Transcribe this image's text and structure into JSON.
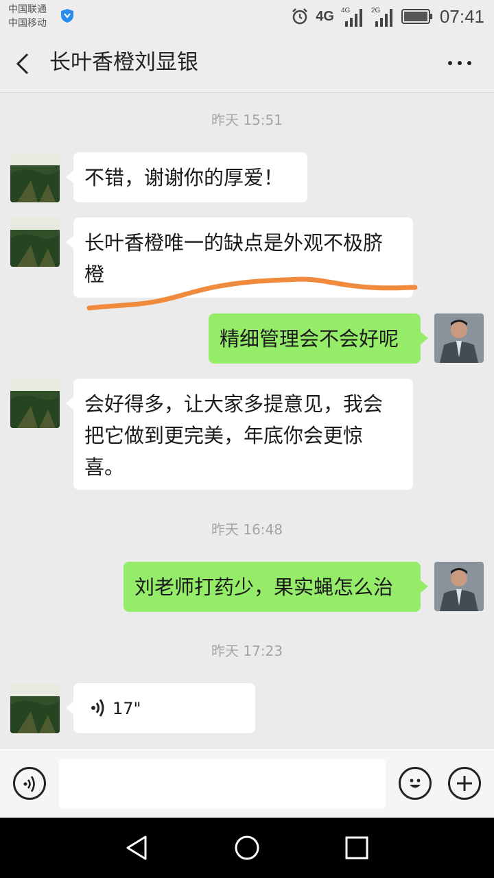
{
  "status_bar": {
    "carrier_1": "中国联通",
    "carrier_2": "中国移动",
    "network_1": "4G",
    "network_2": "4G",
    "network_3": "2G",
    "time": "07:41"
  },
  "header": {
    "title": "长叶香橙刘显银"
  },
  "messages": [
    {
      "kind": "timestamp",
      "text": "昨天 15:51"
    },
    {
      "kind": "incoming",
      "text": "不错，谢谢你的厚爱！"
    },
    {
      "kind": "incoming",
      "text": "长叶香橙唯一的缺点是外观不极脐橙"
    },
    {
      "kind": "outgoing",
      "text": "精细管理会不会好呢"
    },
    {
      "kind": "incoming",
      "text": "会好得多，让大家多提意见，我会把它做到更完美，年底你会更惊喜。"
    },
    {
      "kind": "timestamp",
      "text": "昨天 16:48"
    },
    {
      "kind": "outgoing",
      "text": "刘老师打药少，果实蝇怎么治"
    },
    {
      "kind": "timestamp",
      "text": "昨天 17:23"
    },
    {
      "kind": "incoming-voice",
      "duration": "17\""
    }
  ],
  "colors": {
    "chat_bg": "#ebebeb",
    "outgoing_bubble": "#95ec69",
    "incoming_bubble": "#ffffff",
    "annotation": "#f08a3c"
  }
}
